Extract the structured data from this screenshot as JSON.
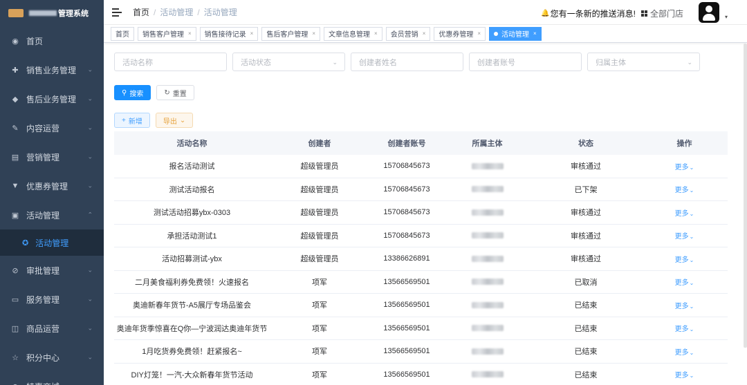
{
  "sidebar": {
    "system_title": "管理系统",
    "items": [
      {
        "label": "首页",
        "icon": "dashboard-icon",
        "glyph": "◉",
        "chevron": ""
      },
      {
        "label": "销售业务管理",
        "icon": "move-icon",
        "glyph": "✚",
        "chevron": "⌄"
      },
      {
        "label": "售后业务管理",
        "icon": "service-icon",
        "glyph": "◆",
        "chevron": "⌄"
      },
      {
        "label": "内容运营",
        "icon": "edit-icon",
        "glyph": "✎",
        "chevron": "⌄"
      },
      {
        "label": "营销管理",
        "icon": "marketing-icon",
        "glyph": "▤",
        "chevron": "⌄"
      },
      {
        "label": "优惠券管理",
        "icon": "shirt-icon",
        "glyph": "▼",
        "chevron": "⌄"
      },
      {
        "label": "活动管理",
        "icon": "activity-icon",
        "glyph": "▣",
        "chevron": "⌃"
      }
    ],
    "submenu_active": {
      "label": "活动管理",
      "icon": "gear-icon",
      "glyph": "✪"
    },
    "items_after": [
      {
        "label": "审批管理",
        "icon": "approval-icon",
        "glyph": "⊘",
        "chevron": "⌄"
      },
      {
        "label": "服务管理",
        "icon": "service-desk-icon",
        "glyph": "▭",
        "chevron": "⌄"
      },
      {
        "label": "商品运营",
        "icon": "product-icon",
        "glyph": "◫",
        "chevron": "⌄"
      },
      {
        "label": "积分中心",
        "icon": "star-icon",
        "glyph": "☆",
        "chevron": "⌄"
      },
      {
        "label": "特惠商城",
        "icon": "mall-icon",
        "glyph": "⊖",
        "chevron": "⌄"
      }
    ]
  },
  "header": {
    "breadcrumb": [
      "首页",
      "活动管理",
      "活动管理"
    ],
    "breadcrumb_sep": "/",
    "notice": "您有一条新的推送消息!",
    "bell_glyph": "🔔",
    "store": "全部门店",
    "caret_glyph": "▾"
  },
  "tags": [
    {
      "label": "首页",
      "closable": false,
      "active": false
    },
    {
      "label": "销售客户管理",
      "closable": true,
      "active": false
    },
    {
      "label": "销售接待记录",
      "closable": true,
      "active": false
    },
    {
      "label": "售后客户管理",
      "closable": true,
      "active": false
    },
    {
      "label": "文章信息管理",
      "closable": true,
      "active": false
    },
    {
      "label": "会员营销",
      "closable": true,
      "active": false
    },
    {
      "label": "优惠券管理",
      "closable": true,
      "active": false
    },
    {
      "label": "活动管理",
      "closable": true,
      "active": true
    }
  ],
  "tag_close_glyph": "×",
  "filters": {
    "activity_name_placeholder": "活动名称",
    "activity_status_placeholder": "活动状态",
    "creator_name_placeholder": "创建者姓名",
    "creator_account_placeholder": "创建者账号",
    "owner_placeholder": "归属主体",
    "dropdown_glyph": "⌄"
  },
  "actions": {
    "search_label": "搜索",
    "search_glyph": "⚲",
    "reset_label": "重置",
    "reset_glyph": "↻",
    "add_label": "新增",
    "add_glyph": "+",
    "export_label": "导出",
    "export_glyph": "⌄"
  },
  "table": {
    "columns": [
      "活动名称",
      "创建者",
      "创建者账号",
      "所属主体",
      "状态",
      "操作"
    ],
    "more_label": "更多",
    "more_glyph": "⌄",
    "rows": [
      {
        "name": "报名活动测试",
        "creator": "超级管理员",
        "account": "15706845673",
        "status": "审核通过"
      },
      {
        "name": "测试活动报名",
        "creator": "超级管理员",
        "account": "15706845673",
        "status": "已下架"
      },
      {
        "name": "测试活动招募ybx-0303",
        "creator": "超级管理员",
        "account": "15706845673",
        "status": "审核通过"
      },
      {
        "name": "承担活动测试1",
        "creator": "超级管理员",
        "account": "15706845673",
        "status": "审核通过"
      },
      {
        "name": "活动招募测试-ybx",
        "creator": "超级管理员",
        "account": "13386626891",
        "status": "审核通过"
      },
      {
        "name": "二月美食福利券免费领！火速报名",
        "creator": "项军",
        "account": "13566569501",
        "status": "已取消"
      },
      {
        "name": "奥迪新春年货节-A5展厅专场品鉴会",
        "creator": "项军",
        "account": "13566569501",
        "status": "已结束"
      },
      {
        "name": "奥迪年货季惊喜在Q你—宁波润达奥迪年货节",
        "creator": "项军",
        "account": "13566569501",
        "status": "已结束"
      },
      {
        "name": "1月吃货券免费领！赶紧报名~",
        "creator": "项军",
        "account": "13566569501",
        "status": "已结束"
      },
      {
        "name": "DIY灯笼！一汽-大众新春年货节活动",
        "creator": "项军",
        "account": "13566569501",
        "status": "已结束"
      }
    ]
  }
}
